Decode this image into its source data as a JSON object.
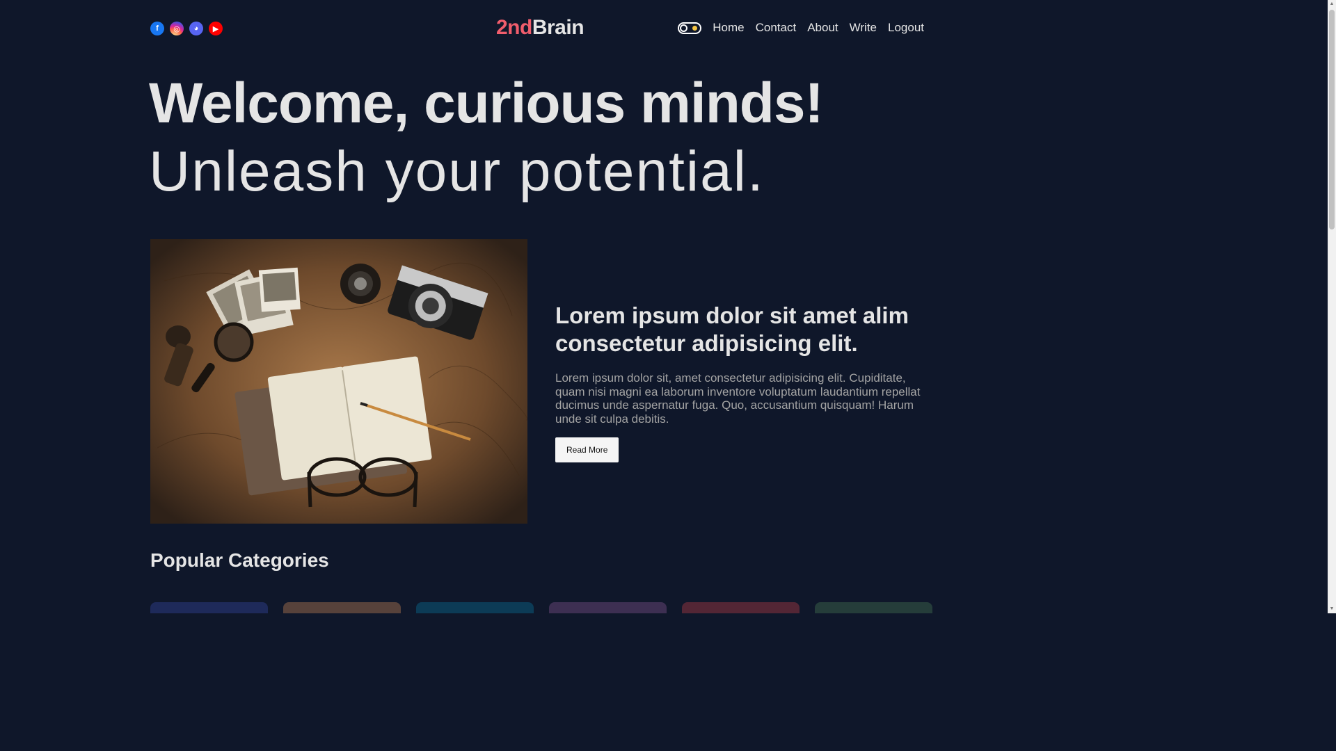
{
  "navbar": {
    "social": [
      {
        "name": "facebook",
        "icon": "facebook-icon",
        "color": "#1877f2",
        "glyph": "f"
      },
      {
        "name": "instagram",
        "icon": "instagram-icon",
        "color": "#d6249f",
        "glyph": "◎"
      },
      {
        "name": "discord",
        "icon": "discord-icon",
        "color": "#5865f2",
        "glyph": "◕"
      },
      {
        "name": "youtube",
        "icon": "youtube-icon",
        "color": "#ff0000",
        "glyph": "▶"
      }
    ],
    "logo_accent": "2nd",
    "logo_rest": "Brain",
    "logo_accent_color": "#f05d6c",
    "theme_toggle_icon": "sun-icon",
    "links": [
      "Home",
      "Contact",
      "About",
      "Write",
      "Logout"
    ]
  },
  "hero": {
    "title": "Welcome, curious minds!",
    "subtitle": "Unleash your potential."
  },
  "featured": {
    "image_icon": "photo-image",
    "title": "Lorem ipsum dolor sit amet alim consectetur adipisicing elit.",
    "description": "Lorem ipsum dolor sit, amet consectetur adipisicing elit. Cupiditate, quam nisi magni ea laborum inventore voluptatum laudantium repellat ducimus unde aspernatur fuga. Quo, accusantium quisquam! Harum unde sit culpa debitis.",
    "button_label": "Read More"
  },
  "categories_section": {
    "title": "Popular Categories",
    "card_colors": [
      "#1e2a5a",
      "#57423b",
      "#0c3b56",
      "#3d2f52",
      "#532635",
      "#253d3a"
    ]
  },
  "colors": {
    "background": "#0f172a",
    "text": "#e5e5e5",
    "muted_text": "#a3a3a3"
  }
}
